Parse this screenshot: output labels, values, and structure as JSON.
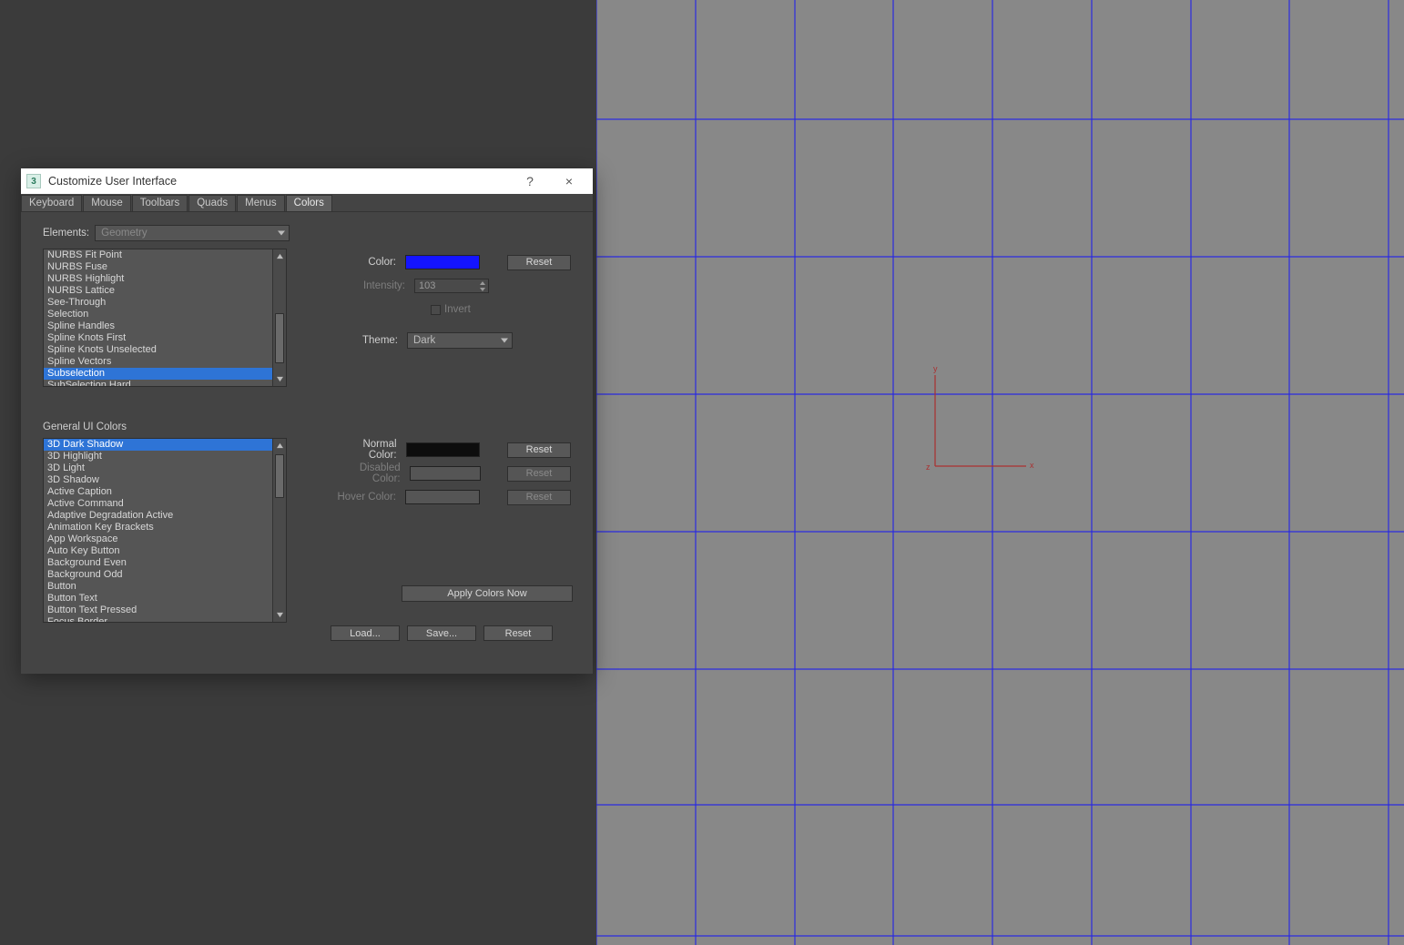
{
  "dialog": {
    "title": "Customize User Interface",
    "app_icon_glyph": "3",
    "help_glyph": "?",
    "close_glyph": "×",
    "tabs": [
      {
        "label": "Keyboard",
        "active": false
      },
      {
        "label": "Mouse",
        "active": false
      },
      {
        "label": "Toolbars",
        "active": false
      },
      {
        "label": "Quads",
        "active": false
      },
      {
        "label": "Menus",
        "active": false
      },
      {
        "label": "Colors",
        "active": true
      }
    ],
    "elements_label": "Elements:",
    "elements_dropdown": "Geometry",
    "geometry_items": [
      "NURBS Fit Point",
      "NURBS Fuse",
      "NURBS Highlight",
      "NURBS Lattice",
      "See-Through",
      "Selection",
      "Spline Handles",
      "Spline Knots First",
      "Spline Knots Unselected",
      "Spline Vectors",
      "Subselection",
      "SubSelection Hard"
    ],
    "geometry_selected_index": 10,
    "color_label": "Color:",
    "color_value": "#1414ff",
    "reset": "Reset",
    "intensity_label": "Intensity:",
    "intensity_value": "103",
    "invert_label": "Invert",
    "theme_label": "Theme:",
    "theme_value": "Dark",
    "general_title": "General UI Colors",
    "general_items": [
      "3D Dark Shadow",
      "3D Highlight",
      "3D Light",
      "3D Shadow",
      "Active Caption",
      "Active Command",
      "Adaptive Degradation Active",
      "Animation Key Brackets",
      "App Workspace",
      "Auto Key Button",
      "Background Even",
      "Background Odd",
      "Button",
      "Button Text",
      "Button Text Pressed",
      "Focus Border"
    ],
    "general_selected_index": 0,
    "normal_color_label": "Normal Color:",
    "disabled_color_label": "Disabled Color:",
    "hover_color_label": "Hover Color:",
    "apply_label": "Apply Colors Now",
    "load_label": "Load...",
    "save_label": "Save...",
    "reset_label": "Reset"
  },
  "viewport": {
    "axis_x": "x",
    "axis_y": "y",
    "axis_z": "z"
  }
}
